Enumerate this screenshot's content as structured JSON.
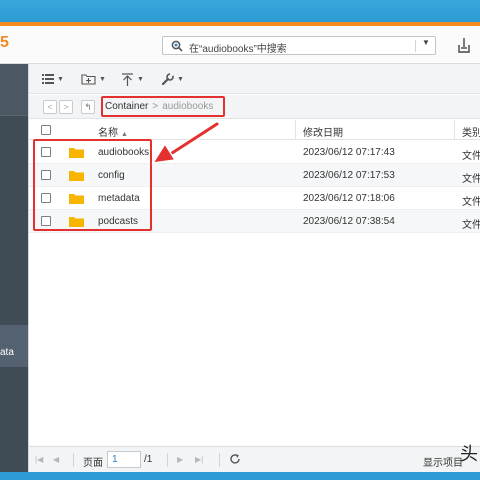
{
  "header": {
    "logo_glyph": "5",
    "search_text": "在“audiobooks”中搜索",
    "search_dropdown": "▼"
  },
  "sidebar": {
    "partial_label": "ata"
  },
  "toolbar": {
    "buttons": [
      {
        "icon": "list-view-icon"
      },
      {
        "icon": "new-folder-icon"
      },
      {
        "icon": "upload-icon"
      },
      {
        "icon": "tools-icon"
      }
    ]
  },
  "breadcrumb": {
    "root": "Container",
    "separator": ">",
    "current": "audiobooks"
  },
  "table": {
    "columns": {
      "name": "名称",
      "modified": "修改日期",
      "type": "类别"
    },
    "rows": [
      {
        "name": "audiobooks",
        "modified": "2023/06/12 07:17:43",
        "type": "文件"
      },
      {
        "name": "config",
        "modified": "2023/06/12 07:17:53",
        "type": "文件"
      },
      {
        "name": "metadata",
        "modified": "2023/06/12 07:18:06",
        "type": "文件"
      },
      {
        "name": "podcasts",
        "modified": "2023/06/12 07:38:54",
        "type": "文件"
      }
    ]
  },
  "pager": {
    "page_label": "页面",
    "page_value": "1",
    "page_total": "/1",
    "show_items": "显示项目"
  },
  "watermark": "头",
  "colors": {
    "accent_orange": "#f28a1e",
    "annotation_red": "#e53030",
    "folder_yellow": "#f7b500",
    "top_blue": "#2b9ad3"
  }
}
